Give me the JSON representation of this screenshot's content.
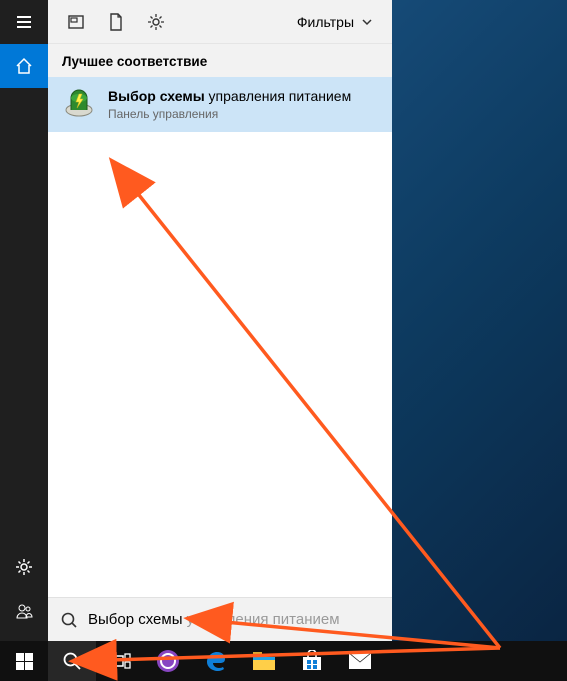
{
  "sidebar": {
    "items": [
      "menu",
      "home",
      "settings",
      "people"
    ]
  },
  "filters": {
    "label": "Фильтры"
  },
  "section": {
    "best_match": "Лучшее соответствие"
  },
  "result": {
    "title_bold": "Выбор схемы",
    "title_rest": " управления питанием",
    "subtitle": "Панель управления"
  },
  "search": {
    "typed": "Выбор схемы",
    "suggestion": " управления питанием"
  },
  "colors": {
    "arrow": "#ff5a1f",
    "accent": "#0078d7",
    "highlight": "#cce4f7"
  }
}
